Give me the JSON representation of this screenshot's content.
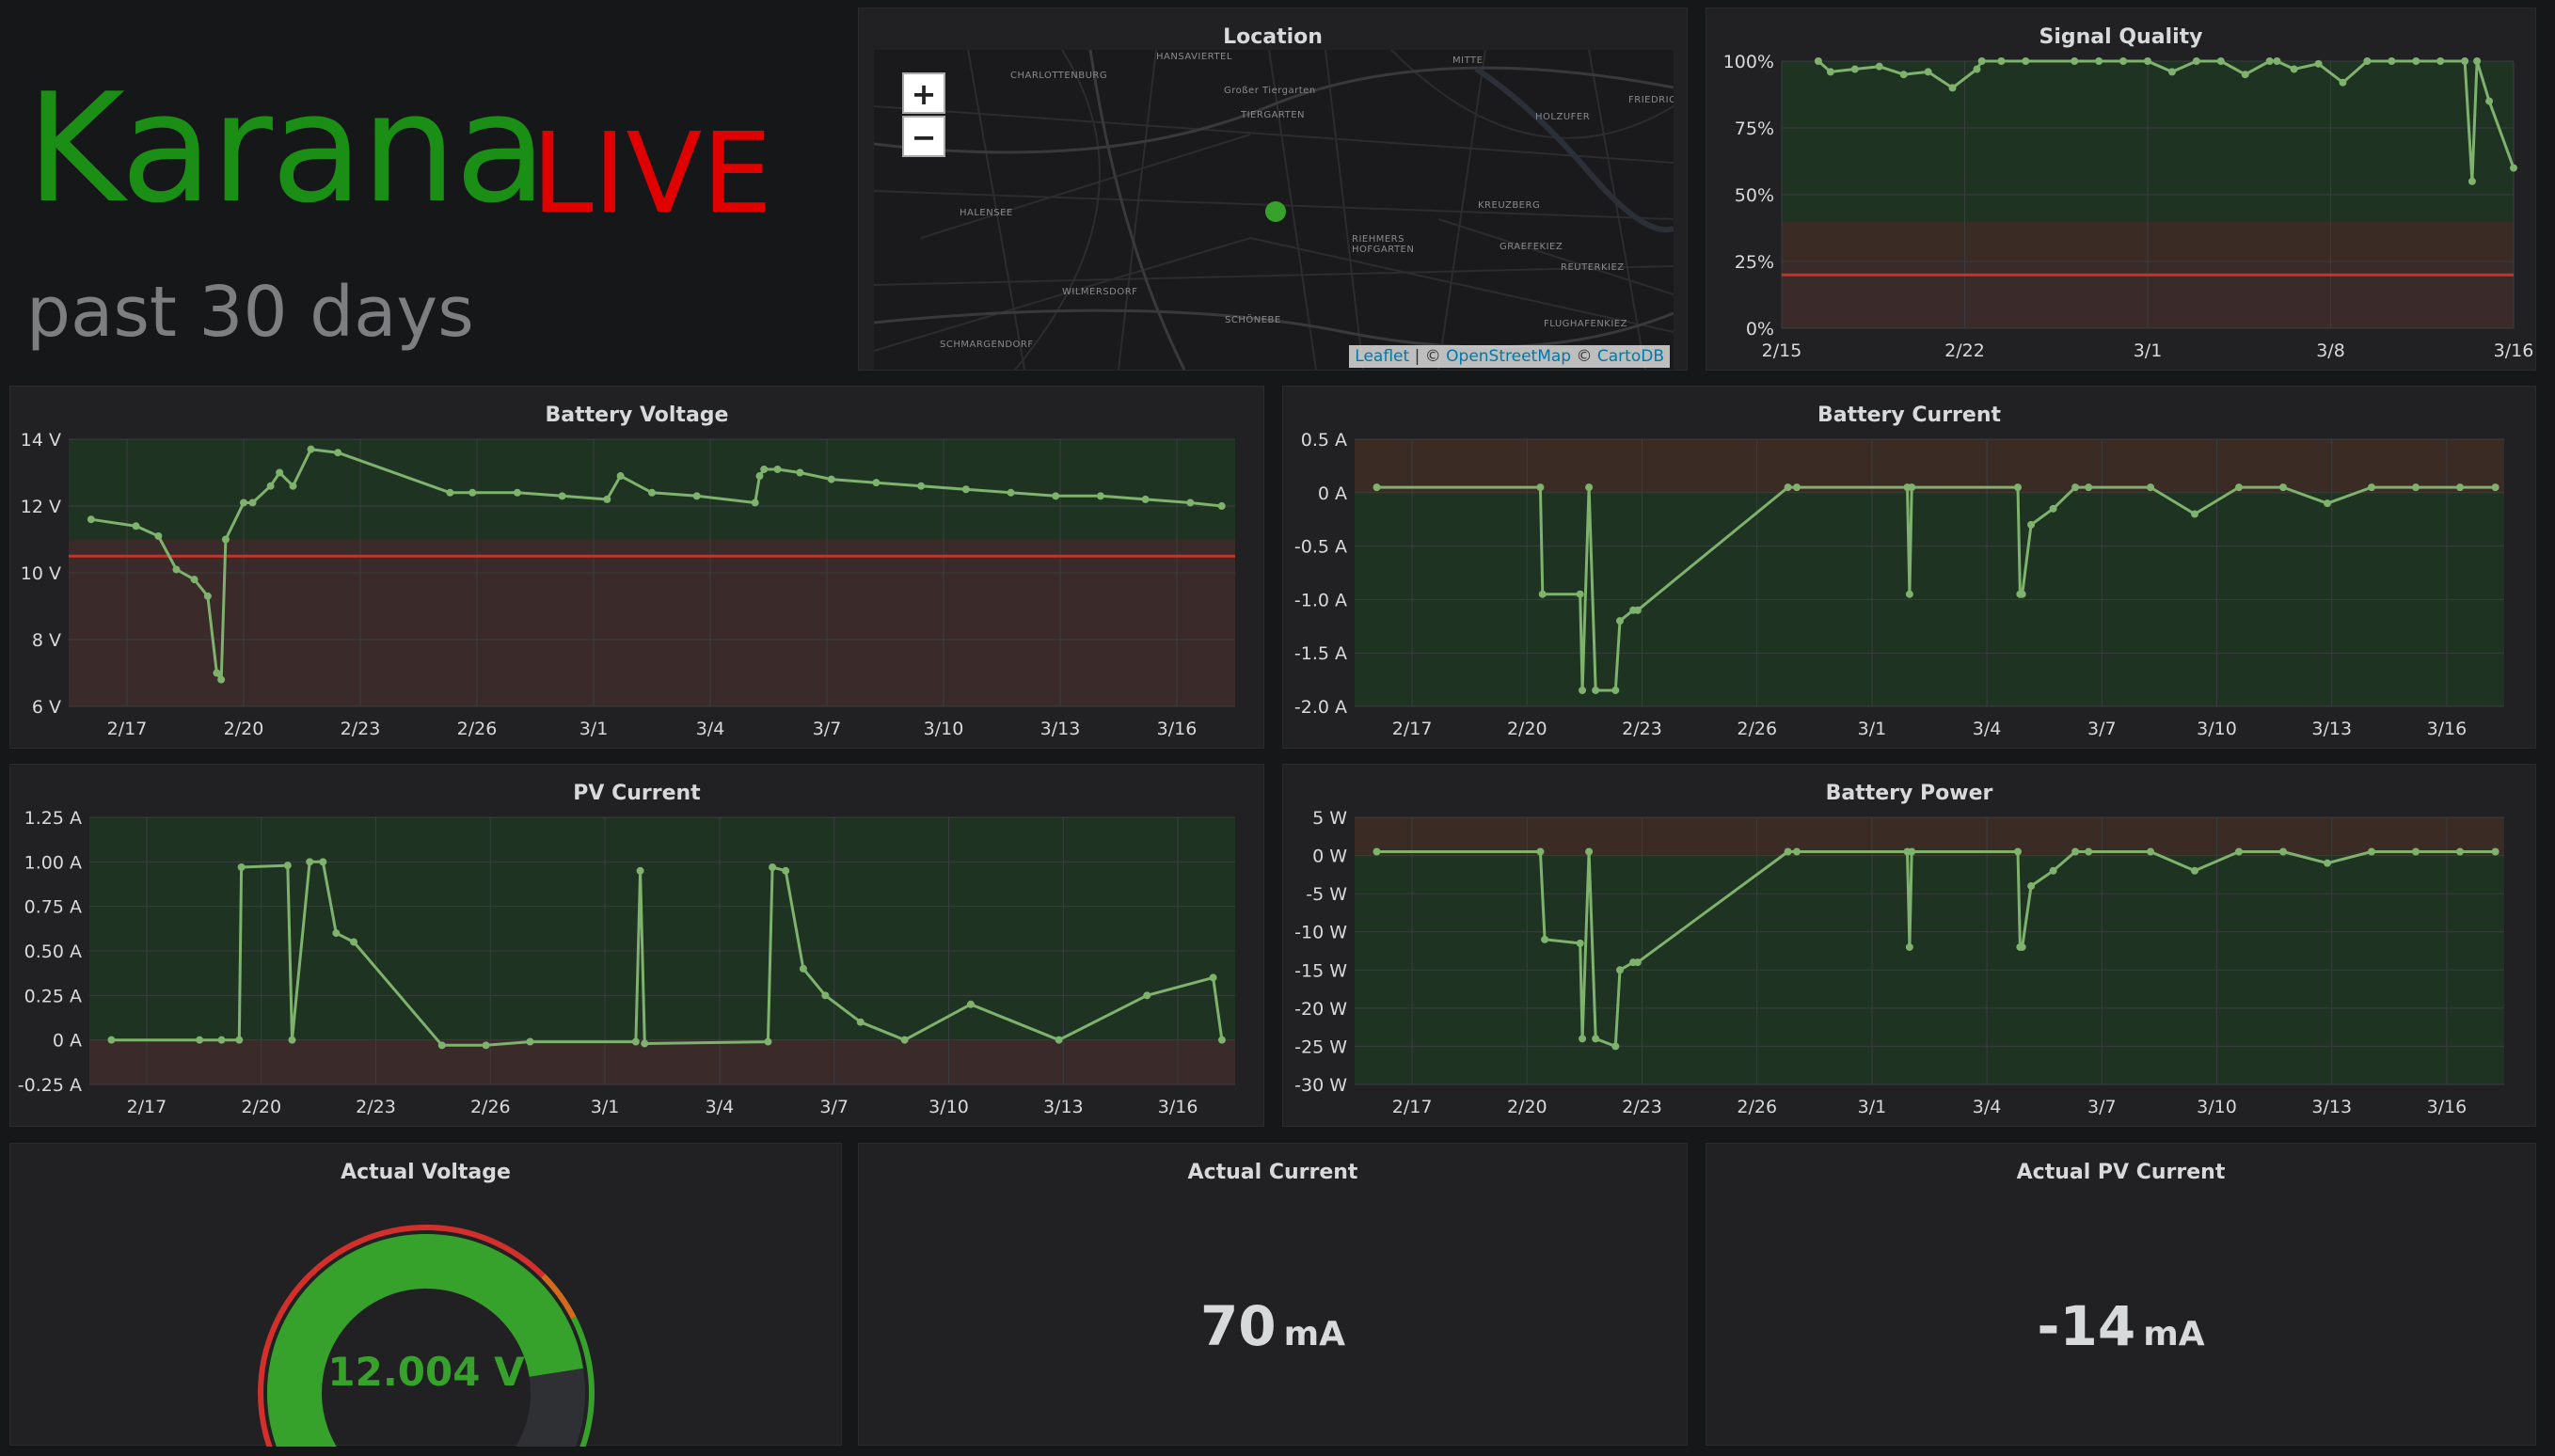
{
  "header": {
    "brand_name": "Karana",
    "brand_live": "LIVE",
    "subtitle": "past 30 days"
  },
  "panels": {
    "location": {
      "title": "Location",
      "zoom_in": "+",
      "zoom_out": "−",
      "attribution": {
        "leaflet": "Leaflet",
        "sep1": " | © ",
        "osm": "OpenStreetMap",
        "sep2": " © ",
        "carto": "CartoDB"
      },
      "labels": [
        "CHARLOTTENBURG",
        "HANSAVIERTEL",
        "MITTE",
        "Großer Tiergarten",
        "TIERGARTEN",
        "HOLZUFER",
        "FRIEDRIC",
        "HALENSEE",
        "KREUZBERG",
        "RIEHMERS HOFGARTEN",
        "GRAEFEKIEZ",
        "REUTERKIEZ",
        "WILMERSDORF",
        "SCHÖNEBE",
        "SCHMARGENDORF",
        "FLUGHAFENKIEZ"
      ]
    },
    "signal_quality": {
      "title": "Signal Quality"
    },
    "battery_voltage": {
      "title": "Battery Voltage"
    },
    "battery_current": {
      "title": "Battery Current"
    },
    "pv_current": {
      "title": "PV Current"
    },
    "battery_power": {
      "title": "Battery Power"
    },
    "actual_voltage": {
      "title": "Actual Voltage",
      "value": "12.004 V",
      "gauge_min": 0,
      "gauge_max": 15,
      "gauge_value": 12.004
    },
    "actual_current": {
      "title": "Actual Current",
      "value": "70",
      "unit": "mA"
    },
    "actual_pv_current": {
      "title": "Actual PV Current",
      "value": "-14",
      "unit": "mA"
    }
  },
  "colors": {
    "series": "#7eb26d",
    "ok_band": "#1f3322",
    "warn_band": "#3a2b24",
    "bad_band": "#3a2a2a",
    "threshold": "#c4342b",
    "gauge_green": "#37a22b",
    "gauge_orange": "#d46b1c",
    "gauge_red": "#d4302b"
  },
  "chart_data": [
    {
      "id": "signal_quality",
      "type": "line",
      "title": "Signal Quality",
      "x_ticks": [
        "2/15",
        "2/22",
        "3/1",
        "3/8",
        "3/16"
      ],
      "y_ticks": [
        "100%",
        "75%",
        "50%",
        "25%",
        "0%"
      ],
      "ylim": [
        0,
        100
      ],
      "threshold": 20,
      "series": [
        {
          "x": [
            1.5,
            2,
            3,
            4,
            5,
            6,
            7,
            8,
            8.2,
            9,
            10,
            12,
            13,
            14,
            15,
            16,
            17,
            18,
            19,
            20,
            20.3,
            21,
            22,
            23,
            24,
            25,
            26,
            27,
            28,
            28.3,
            28.5,
            29,
            30
          ],
          "y": [
            100,
            96,
            97,
            98,
            95,
            96,
            90,
            97,
            100,
            100,
            100,
            100,
            100,
            100,
            100,
            96,
            100,
            100,
            95,
            100,
            100,
            97,
            99,
            92,
            100,
            100,
            100,
            100,
            100,
            55,
            100,
            85,
            60
          ]
        }
      ]
    },
    {
      "id": "battery_voltage",
      "type": "line",
      "title": "Battery Voltage",
      "x_ticks": [
        "2/17",
        "2/20",
        "2/23",
        "2/26",
        "3/1",
        "3/4",
        "3/7",
        "3/10",
        "3/13",
        "3/16"
      ],
      "y_ticks": [
        "14 V",
        "12 V",
        "10 V",
        "8 V",
        "6 V"
      ],
      "ylim": [
        6,
        14
      ],
      "threshold": 10.5,
      "series": [
        {
          "x": [
            0.5,
            1.5,
            2.0,
            2.4,
            2.8,
            3.1,
            3.3,
            3.4,
            3.5,
            3.9,
            4.1,
            4.5,
            4.7,
            5.0,
            5.4,
            6.0,
            8.5,
            9.0,
            10.0,
            11.0,
            12.0,
            12.3,
            13.0,
            14.0,
            15.3,
            15.4,
            15.5,
            15.8,
            16.3,
            17.0,
            18.0,
            19.0,
            20.0,
            21.0,
            22.0,
            23.0,
            24.0,
            25.0,
            25.7
          ],
          "y": [
            11.6,
            11.4,
            11.1,
            10.1,
            9.8,
            9.3,
            7.0,
            6.8,
            11.0,
            12.1,
            12.1,
            12.6,
            13.0,
            12.6,
            13.7,
            13.6,
            12.4,
            12.4,
            12.4,
            12.3,
            12.2,
            12.9,
            12.4,
            12.3,
            12.1,
            12.9,
            13.1,
            13.1,
            13.0,
            12.8,
            12.7,
            12.6,
            12.5,
            12.4,
            12.3,
            12.3,
            12.2,
            12.1,
            12.0
          ]
        }
      ]
    },
    {
      "id": "battery_current",
      "type": "line",
      "title": "Battery Current",
      "x_ticks": [
        "2/17",
        "2/20",
        "2/23",
        "2/26",
        "3/1",
        "3/4",
        "3/7",
        "3/10",
        "3/13",
        "3/16"
      ],
      "y_ticks": [
        "0.5 A",
        "0 A",
        "-0.5 A",
        "-1.0 A",
        "-1.5 A",
        "-2.0 A"
      ],
      "ylim": [
        -2.0,
        0.5
      ],
      "series": [
        {
          "x": [
            0.5,
            4.2,
            4.25,
            5.1,
            5.15,
            5.3,
            5.45,
            5.9,
            6.0,
            6.3,
            6.4,
            9.8,
            10.0,
            12.5,
            12.55,
            12.6,
            15.0,
            15.05,
            15.1,
            15.3,
            15.8,
            16.3,
            16.6,
            18.0,
            19.0,
            20.0,
            21.0,
            22.0,
            23.0,
            24.0,
            25.0,
            25.8
          ],
          "y": [
            0.05,
            0.05,
            -0.95,
            -0.95,
            -1.85,
            0.05,
            -1.85,
            -1.85,
            -1.2,
            -1.1,
            -1.1,
            0.05,
            0.05,
            0.05,
            -0.95,
            0.05,
            0.05,
            -0.95,
            -0.95,
            -0.3,
            -0.15,
            0.05,
            0.05,
            0.05,
            -0.2,
            0.05,
            0.05,
            -0.1,
            0.05,
            0.05,
            0.05,
            0.05
          ]
        }
      ]
    },
    {
      "id": "pv_current",
      "type": "line",
      "title": "PV Current",
      "x_ticks": [
        "2/17",
        "2/20",
        "2/23",
        "2/26",
        "3/1",
        "3/4",
        "3/7",
        "3/10",
        "3/13",
        "3/16"
      ],
      "y_ticks": [
        "1.25 A",
        "1.00 A",
        "0.75 A",
        "0.50 A",
        "0.25 A",
        "0 A",
        "-0.25 A"
      ],
      "ylim": [
        -0.25,
        1.25
      ],
      "series": [
        {
          "x": [
            0.5,
            2.5,
            3.0,
            3.4,
            3.45,
            4.5,
            4.6,
            5.0,
            5.3,
            5.6,
            6.0,
            8.0,
            9.0,
            10.0,
            12.4,
            12.5,
            12.6,
            15.4,
            15.5,
            15.8,
            16.2,
            16.7,
            17.5,
            18.5,
            20.0,
            22.0,
            24.0,
            25.5,
            25.7
          ],
          "y": [
            0,
            0,
            0,
            0.0,
            0.97,
            0.98,
            0.0,
            1.0,
            1.0,
            0.6,
            0.55,
            -0.03,
            -0.03,
            -0.01,
            -0.01,
            0.95,
            -0.02,
            -0.01,
            0.97,
            0.95,
            0.4,
            0.25,
            0.1,
            0.0,
            0.2,
            0.0,
            0.25,
            0.35,
            0.0
          ]
        }
      ]
    },
    {
      "id": "battery_power",
      "type": "line",
      "title": "Battery Power",
      "x_ticks": [
        "2/17",
        "2/20",
        "2/23",
        "2/26",
        "3/1",
        "3/4",
        "3/7",
        "3/10",
        "3/13",
        "3/16"
      ],
      "y_ticks": [
        "5 W",
        "0 W",
        "-5 W",
        "-10 W",
        "-15 W",
        "-20 W",
        "-25 W",
        "-30 W"
      ],
      "ylim": [
        -30,
        5
      ],
      "series": [
        {
          "x": [
            0.5,
            4.2,
            4.3,
            5.1,
            5.15,
            5.3,
            5.45,
            5.9,
            6.0,
            6.3,
            6.4,
            9.8,
            10.0,
            12.5,
            12.55,
            12.6,
            15.0,
            15.05,
            15.1,
            15.3,
            15.8,
            16.3,
            16.6,
            18.0,
            19.0,
            20.0,
            21.0,
            22.0,
            23.0,
            24.0,
            25.0,
            25.8
          ],
          "y": [
            0.5,
            0.5,
            -11,
            -11.5,
            -24,
            0.5,
            -24,
            -25,
            -15,
            -14,
            -14,
            0.5,
            0.5,
            0.5,
            -12,
            0.5,
            0.5,
            -12,
            -12,
            -4,
            -2,
            0.5,
            0.5,
            0.5,
            -2,
            0.5,
            0.5,
            -1,
            0.5,
            0.5,
            0.5,
            0.5
          ]
        }
      ]
    }
  ]
}
